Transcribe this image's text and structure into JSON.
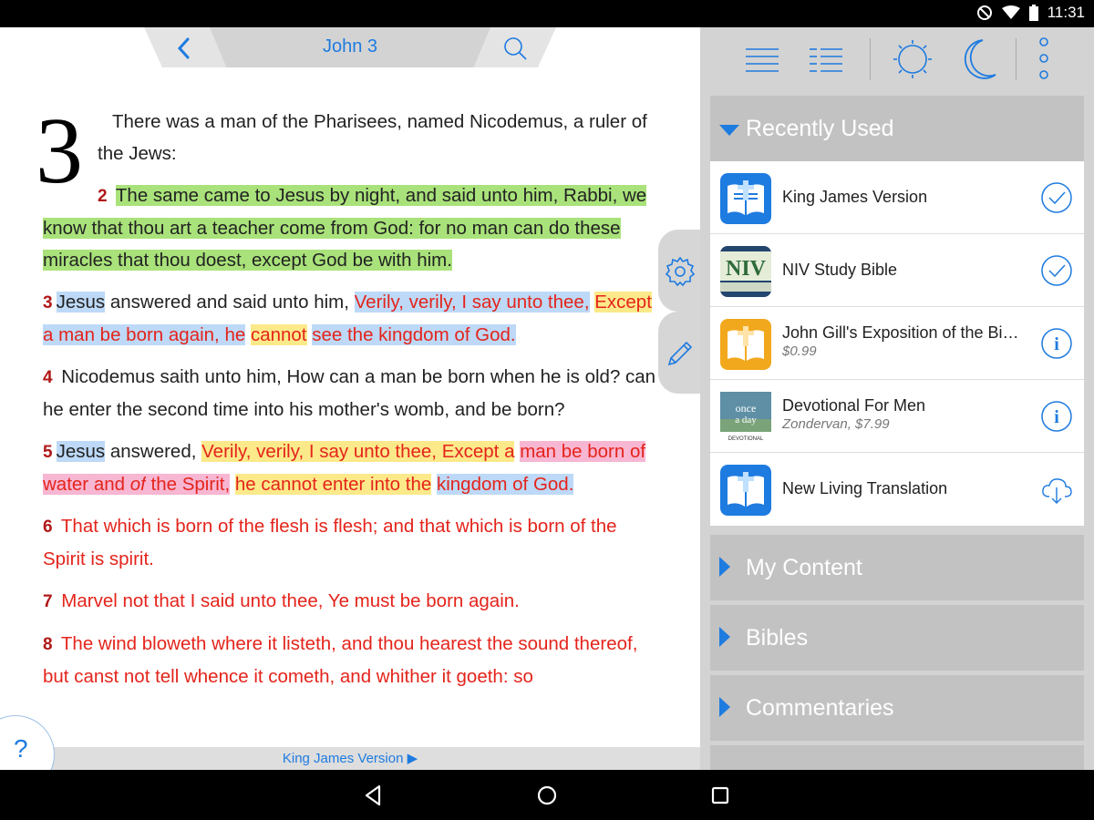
{
  "status_bar": {
    "time": "11:31"
  },
  "reader": {
    "chapter_title": "John 3",
    "chapter_number": "3",
    "verse1_text": "There was a man of the Pharisees, named Nicodemus, a ruler of the Jews:",
    "verses": {
      "v2": {
        "num": "2",
        "text": "The same came to Jesus by night, and said unto him, Rabbi, we know that thou art a teacher come from God: for no man can do these miracles that thou doest, except God be with him."
      },
      "v3": {
        "num": "3",
        "s1": "Jesus",
        "s2": " answered and said unto him, ",
        "s3": "Verily, verily, I say unto thee,",
        "s4": " ",
        "s5": "Except",
        "s6": " ",
        "s7": "a man be born again, he",
        "s8": " ",
        "s9": "cannot",
        "s10": " ",
        "s11": "see the kingdom of God."
      },
      "v4": {
        "num": "4",
        "text": "Nicodemus saith unto him, How can a man be born when he is old? can he enter the second time into his mother's womb, and be born?"
      },
      "v5": {
        "num": "5",
        "s1": "Jesus",
        "s2": " answered, ",
        "s3": "Verily, verily, I say unto thee, Except a",
        "s4": " ",
        "s5": "man be born of water and ",
        "s6": "of",
        "s7": " the Spirit,",
        "s8": " ",
        "s9": "he cannot enter into the",
        "s10": " ",
        "s11": "kingdom of God."
      },
      "v6": {
        "num": "6",
        "text": "That which is born of the flesh is flesh; and that which is born of the Spirit is spirit."
      },
      "v7": {
        "num": "7",
        "text": "Marvel not that I said unto thee, Ye must be born again."
      },
      "v8": {
        "num": "8",
        "text": "The wind bloweth where it listeth, and thou hearest the sound thereof, but canst not tell whence it cometh, and whither it goeth: so"
      }
    },
    "version_label": "King James Version ▶",
    "help_label": "?"
  },
  "library": {
    "recently_used": {
      "label": "Recently Used",
      "items": [
        {
          "title": "King James Version",
          "subtitle": "",
          "icon": "bible-book-icon",
          "action": "check-icon"
        },
        {
          "title": "NIV Study Bible",
          "subtitle": "",
          "icon": "niv-icon",
          "action": "check-icon"
        },
        {
          "title": "John Gill's Exposition of the Bi…",
          "subtitle": "$0.99",
          "icon": "orange-bible-icon",
          "action": "info-icon"
        },
        {
          "title": "Devotional For Men",
          "subtitle": "Zondervan, $7.99",
          "icon": "once-a-day-icon",
          "action": "info-icon"
        },
        {
          "title": "New Living Translation",
          "subtitle": "",
          "icon": "bible-book-icon",
          "action": "cloud-download-icon"
        }
      ]
    },
    "groups": [
      {
        "label": "My Content"
      },
      {
        "label": "Bibles"
      },
      {
        "label": "Commentaries"
      }
    ],
    "cover_text": {
      "niv": "NIV",
      "once": "once",
      "a_day": "a day",
      "devotional": "DEVOTIONAL"
    }
  },
  "colors": {
    "accent": "#1e7be0",
    "words_of_christ": "#e4241b",
    "verse_number": "#b01818",
    "highlight_green": "#a9e27a",
    "highlight_blue": "#bdd9f7",
    "highlight_yellow": "#fbe98a",
    "highlight_pink": "#f7b6d2"
  }
}
